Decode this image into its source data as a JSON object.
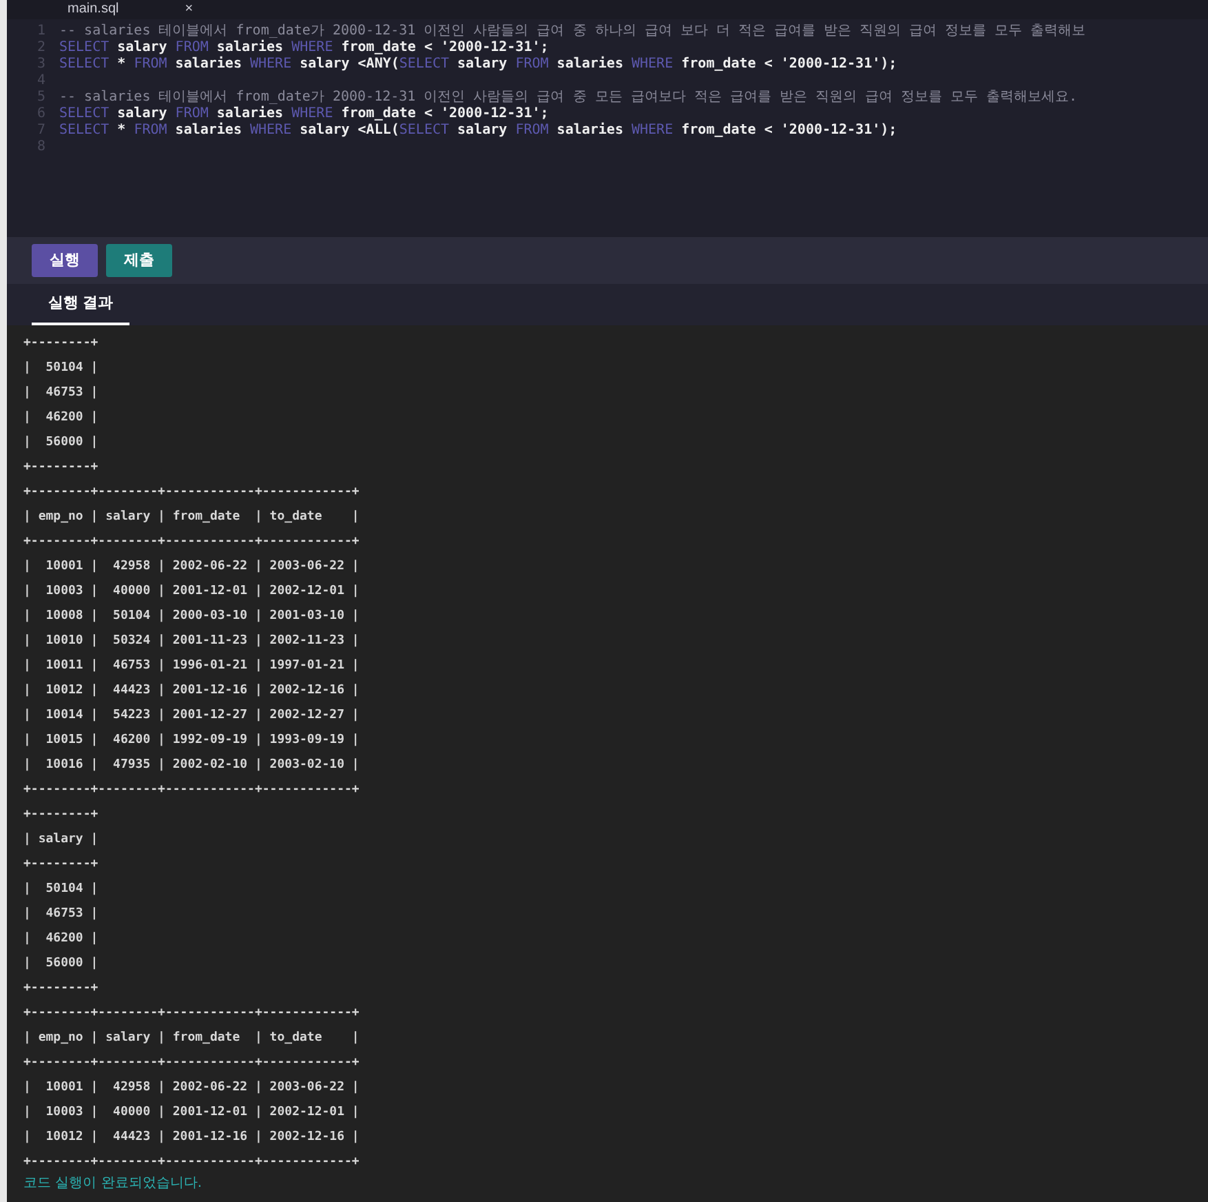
{
  "editor_tab": {
    "title": "main.sql",
    "close": "×"
  },
  "code_lines": [
    {
      "number": "1",
      "tokens": [
        {
          "kind": "comment",
          "text": "-- salaries 테이블에서 from_date가 2000-12-31 이전인 사람들의 급여 중 하나의 급여 보다 더 적은 급여를 받은 직원의 급여 정보를 모두 출력해보"
        }
      ]
    },
    {
      "number": "2",
      "tokens": [
        {
          "kind": "keyword",
          "text": "SELECT"
        },
        {
          "kind": "ident",
          "text": " salary "
        },
        {
          "kind": "keyword",
          "text": "FROM"
        },
        {
          "kind": "ident",
          "text": " salaries "
        },
        {
          "kind": "keyword",
          "text": "WHERE"
        },
        {
          "kind": "ident",
          "text": " from_date < '2000-12-31';"
        }
      ]
    },
    {
      "number": "3",
      "tokens": [
        {
          "kind": "keyword",
          "text": "SELECT"
        },
        {
          "kind": "ident",
          "text": " * "
        },
        {
          "kind": "keyword",
          "text": "FROM"
        },
        {
          "kind": "ident",
          "text": " salaries "
        },
        {
          "kind": "keyword",
          "text": "WHERE"
        },
        {
          "kind": "ident",
          "text": " salary <ANY("
        },
        {
          "kind": "keyword",
          "text": "SELECT"
        },
        {
          "kind": "ident",
          "text": " salary "
        },
        {
          "kind": "keyword",
          "text": "FROM"
        },
        {
          "kind": "ident",
          "text": " salaries "
        },
        {
          "kind": "keyword",
          "text": "WHERE"
        },
        {
          "kind": "ident",
          "text": " from_date < '2000-12-31');"
        }
      ]
    },
    {
      "number": "4"
    },
    {
      "number": "5",
      "tokens": [
        {
          "kind": "comment",
          "text": "-- salaries 테이블에서 from_date가 2000-12-31 이전인 사람들의 급여 중 모든 급여보다 적은 급여를 받은 직원의 급여 정보를 모두 출력해보세요."
        }
      ]
    },
    {
      "number": "6",
      "tokens": [
        {
          "kind": "keyword",
          "text": "SELECT"
        },
        {
          "kind": "ident",
          "text": " salary "
        },
        {
          "kind": "keyword",
          "text": "FROM"
        },
        {
          "kind": "ident",
          "text": " salaries "
        },
        {
          "kind": "keyword",
          "text": "WHERE"
        },
        {
          "kind": "ident",
          "text": " from_date < '2000-12-31';"
        }
      ]
    },
    {
      "number": "7",
      "tokens": [
        {
          "kind": "keyword",
          "text": "SELECT"
        },
        {
          "kind": "ident",
          "text": " * "
        },
        {
          "kind": "keyword",
          "text": "FROM"
        },
        {
          "kind": "ident",
          "text": " salaries "
        },
        {
          "kind": "keyword",
          "text": "WHERE"
        },
        {
          "kind": "ident",
          "text": " salary <ALL("
        },
        {
          "kind": "keyword",
          "text": "SELECT"
        },
        {
          "kind": "ident",
          "text": " salary "
        },
        {
          "kind": "keyword",
          "text": "FROM"
        },
        {
          "kind": "ident",
          "text": " salaries "
        },
        {
          "kind": "keyword",
          "text": "WHERE"
        },
        {
          "kind": "ident",
          "text": " from_date < '2000-12-31');"
        }
      ]
    },
    {
      "number": "8"
    }
  ],
  "buttons": [
    {
      "label": "실행",
      "kind": "run"
    },
    {
      "label": "제출",
      "kind": "submit"
    }
  ],
  "result_tabs": [
    {
      "label": "실행 결과",
      "selected": true
    }
  ],
  "output_lines": [
    "+--------+",
    "|  50104 |",
    "|  46753 |",
    "|  46200 |",
    "|  56000 |",
    "+--------+",
    "+--------+--------+------------+------------+",
    "| emp_no | salary | from_date  | to_date    |",
    "+--------+--------+------------+------------+",
    "|  10001 |  42958 | 2002-06-22 | 2003-06-22 |",
    "|  10003 |  40000 | 2001-12-01 | 2002-12-01 |",
    "|  10008 |  50104 | 2000-03-10 | 2001-03-10 |",
    "|  10010 |  50324 | 2001-11-23 | 2002-11-23 |",
    "|  10011 |  46753 | 1996-01-21 | 1997-01-21 |",
    "|  10012 |  44423 | 2001-12-16 | 2002-12-16 |",
    "|  10014 |  54223 | 2001-12-27 | 2002-12-27 |",
    "|  10015 |  46200 | 1992-09-19 | 1993-09-19 |",
    "|  10016 |  47935 | 2002-02-10 | 2003-02-10 |",
    "+--------+--------+------------+------------+",
    "+--------+",
    "| salary |",
    "+--------+",
    "|  50104 |",
    "|  46753 |",
    "|  46200 |",
    "|  56000 |",
    "+--------+",
    "+--------+--------+------------+------------+",
    "| emp_no | salary | from_date  | to_date    |",
    "+--------+--------+------------+------------+",
    "|  10001 |  42958 | 2002-06-22 | 2003-06-22 |",
    "|  10003 |  40000 | 2001-12-01 | 2002-12-01 |",
    "|  10012 |  44423 | 2001-12-16 | 2002-12-16 |",
    "+--------+--------+------------+------------+"
  ],
  "status_message": "코드 실행이 완료되었습니다."
}
